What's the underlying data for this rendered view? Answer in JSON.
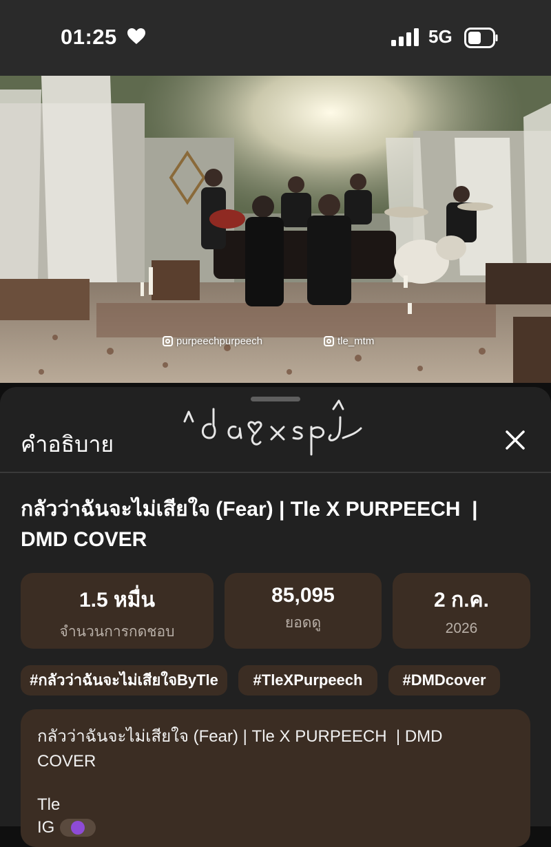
{
  "status_bar": {
    "time": "01:25",
    "network": "5G",
    "heart_icon": "heart-icon",
    "signal_icon": "signal-icon",
    "battery_icon": "battery-icon"
  },
  "video": {
    "watermarks": [
      "purpeechpurpeech",
      "tle_mtm"
    ]
  },
  "sheet": {
    "title": "คำอธิบาย",
    "close_icon": "close-icon"
  },
  "video_title": "กลัวว่าฉันจะไม่เสียใจ (Fear) | Tle X PURPEECH  |\nDMD COVER",
  "stats": [
    {
      "value": "1.5 หมื่น",
      "label": "จำนวนการกดชอบ"
    },
    {
      "value": "85,095",
      "label": "ยอดดู"
    },
    {
      "value": "2 ก.ค.",
      "label": "2026"
    }
  ],
  "hashtags": [
    "#กลัวว่าฉันจะไม่เสียใจByTle",
    "#TleXPurpeech",
    "#DMDcover"
  ],
  "description": {
    "text": "กลัวว่าฉันจะไม่เสียใจ (Fear) | Tle X PURPEECH  | DMD\nCOVER",
    "line2": "Tle",
    "line3_prefix": "IG"
  },
  "colors": {
    "background": "#0f0f0f",
    "sheet": "#212121",
    "card": "#3b2d23",
    "status_bar": "#2a2a2a"
  }
}
